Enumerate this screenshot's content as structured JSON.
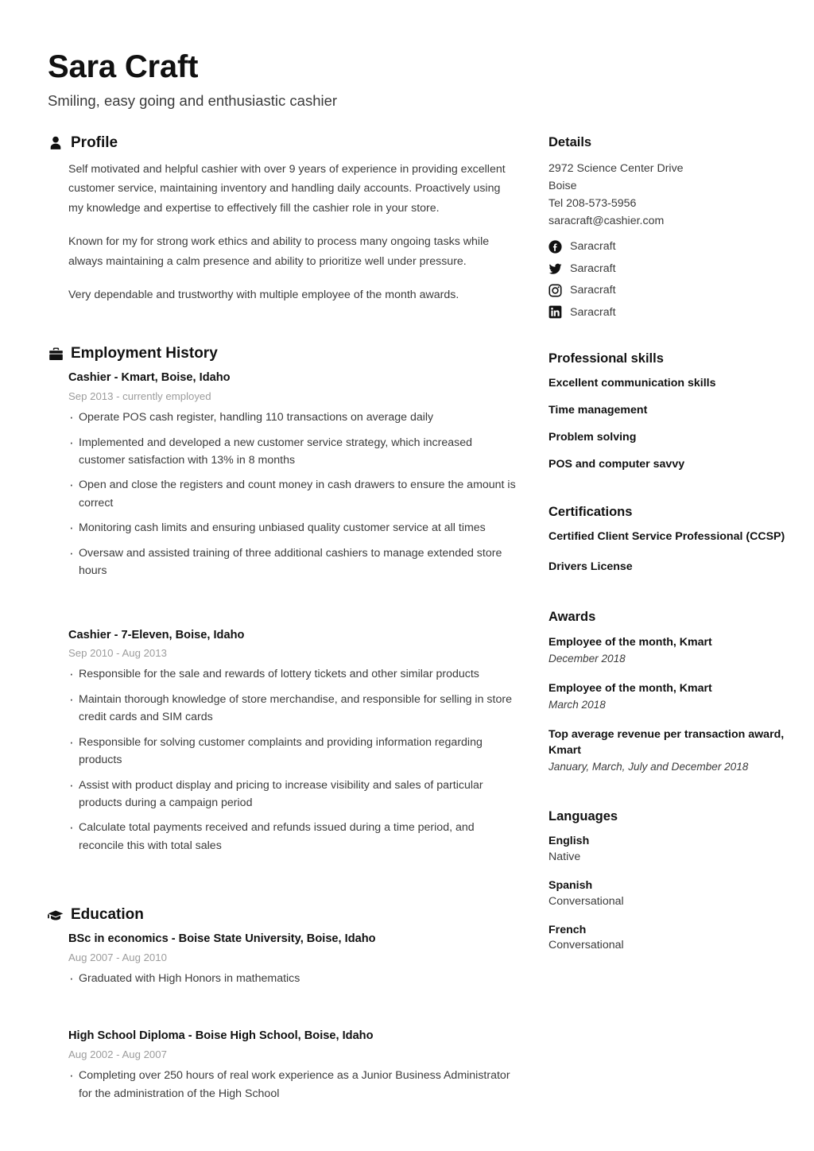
{
  "header": {
    "name": "Sara Craft",
    "tagline": "Smiling, easy going and enthusiastic cashier"
  },
  "profile": {
    "icon": "person-icon",
    "title": "Profile",
    "paragraphs": [
      "Self motivated and helpful cashier with over 9 years of experience in providing excellent customer service, maintaining inventory and handling daily accounts. Proactively using my knowledge and expertise to effectively fill the cashier role in your store.",
      "Known for my for strong work ethics and ability to process many ongoing tasks while always maintaining a calm presence and ability to prioritize well under pressure.",
      "Very dependable and trustworthy with multiple employee of the month awards."
    ]
  },
  "employment": {
    "icon": "briefcase-icon",
    "title": "Employment History",
    "entries": [
      {
        "title": "Cashier - Kmart, Boise, Idaho",
        "date": "Sep 2013 - currently employed",
        "bullets": [
          "Operate POS cash register, handling 110 transactions on average daily",
          "Implemented and developed a new customer service strategy, which increased customer satisfaction with 13% in 8 months",
          "Open and close the registers and count money in cash drawers to ensure the amount is correct",
          "Monitoring cash limits and ensuring unbiased quality customer service at all times",
          "Oversaw and assisted training of three additional cashiers to manage extended store hours"
        ]
      },
      {
        "title": "Cashier - 7-Eleven, Boise, Idaho",
        "date": "Sep 2010 - Aug 2013",
        "bullets": [
          "Responsible for the sale and rewards of lottery tickets and other similar products",
          "Maintain thorough knowledge of store merchandise, and responsible for selling in store credit cards and SIM cards",
          "Responsible for solving customer complaints and providing information regarding products",
          "Assist with product display and pricing to increase visibility and sales of particular products during a campaign period",
          "Calculate total payments received and refunds issued during a time period, and reconcile this with total sales"
        ]
      }
    ]
  },
  "education": {
    "icon": "graduation-cap-icon",
    "title": "Education",
    "entries": [
      {
        "title": "BSc in economics - Boise State University, Boise, Idaho",
        "date": "Aug 2007 - Aug 2010",
        "bullets": [
          "Graduated with High Honors in mathematics"
        ]
      },
      {
        "title": "High School Diploma - Boise High School, Boise, Idaho",
        "date": "Aug 2002 - Aug 2007",
        "bullets": [
          "Completing over 250 hours of real work experience as a Junior Business Administrator for the administration of the High School"
        ]
      }
    ]
  },
  "details": {
    "title": "Details",
    "address_line1": "2972 Science Center Drive",
    "address_line2": "Boise",
    "phone": "Tel 208-573-5956",
    "email": "saracraft@cashier.com",
    "socials": [
      {
        "icon": "facebook-icon",
        "handle": "Saracraft"
      },
      {
        "icon": "twitter-icon",
        "handle": "Saracraft"
      },
      {
        "icon": "instagram-icon",
        "handle": "Saracraft"
      },
      {
        "icon": "linkedin-icon",
        "handle": "Saracraft"
      }
    ]
  },
  "skills": {
    "title": "Professional skills",
    "items": [
      "Excellent communication skills",
      "Time management",
      "Problem solving",
      "POS and computer savvy"
    ]
  },
  "certifications": {
    "title": "Certifications",
    "items": [
      "Certified Client Service Professional (CCSP)",
      "Drivers License"
    ]
  },
  "awards": {
    "title": "Awards",
    "items": [
      {
        "title": "Employee of the month, Kmart",
        "date": "December 2018"
      },
      {
        "title": "Employee of the month, Kmart",
        "date": "March 2018"
      },
      {
        "title": "Top average revenue per transaction award, Kmart",
        "date": "January, March, July and December 2018"
      }
    ]
  },
  "languages": {
    "title": "Languages",
    "items": [
      {
        "name": "English",
        "level": "Native"
      },
      {
        "name": "Spanish",
        "level": "Conversational"
      },
      {
        "name": "French",
        "level": "Conversational"
      }
    ]
  },
  "colors": {
    "heading": "#111111",
    "body": "#3b3b3b",
    "muted": "#9c9c9c",
    "background": "#ffffff"
  }
}
